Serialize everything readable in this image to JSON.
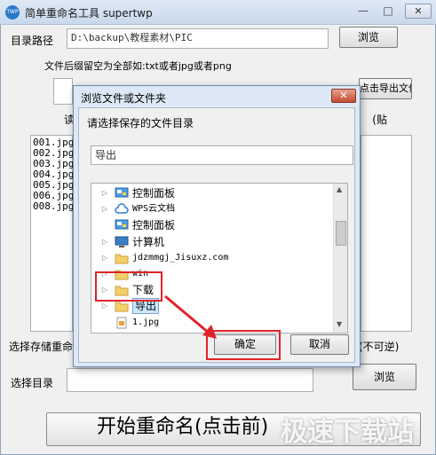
{
  "app": {
    "title": "简单重命名工具 supertwp",
    "icon_text": "TWP",
    "minimize": "—",
    "maximize": "□",
    "close": "✕"
  },
  "form": {
    "dir_label": "目录路径",
    "dir_value": "D:\\backup\\教程素材\\PIC",
    "browse1": "浏览",
    "ext_hint": "文件后缀留空为全部如:txt或者jpg或者png",
    "ext_value": "",
    "left_partial": "读",
    "right_btn_partial": "点击导出文件名到excel处理",
    "right_paren_partial": "贴)",
    "files": [
      "001.jpg",
      "002.jpg",
      "003.jpg",
      "004.jpg",
      "005.jpg",
      "006.jpg",
      "008.jpg"
    ],
    "save_label_partial": "选择存储重命",
    "irrev_partial": "(不可逆)",
    "choose_dir_label": "选择目录",
    "choose_dir_value": "",
    "browse2": "浏览",
    "start_button": "开始重命名(点击前)"
  },
  "dialog": {
    "title": "浏览文件或文件夹",
    "close": "✕",
    "prompt": "请选择保存的文件目录",
    "folder_value": "导出",
    "tree": [
      {
        "label": "控制面板",
        "expandable": true,
        "icon": "control-panel-icon"
      },
      {
        "label": "WPS云文档",
        "expandable": true,
        "icon": "cloud-icon"
      },
      {
        "label": "控制面板",
        "expandable": false,
        "icon": "control-panel-icon"
      },
      {
        "label": "计算机",
        "expandable": true,
        "icon": "computer-icon"
      },
      {
        "label": "jdzmmgj_Jisuxz.com",
        "expandable": true,
        "icon": "folder-icon"
      },
      {
        "label": "win",
        "expandable": true,
        "icon": "folder-icon"
      },
      {
        "label": "下载",
        "expandable": true,
        "icon": "folder-icon"
      },
      {
        "label": "导出",
        "expandable": true,
        "icon": "folder-icon",
        "selected": true
      },
      {
        "label": "1.jpg",
        "expandable": false,
        "icon": "image-file-icon"
      }
    ],
    "ok": "确定",
    "cancel": "取消"
  },
  "watermark": "极速下载站",
  "colors": {
    "highlight_red": "#e0232a",
    "arrow_red": "#e0232a",
    "selection": "#cce8ff"
  }
}
